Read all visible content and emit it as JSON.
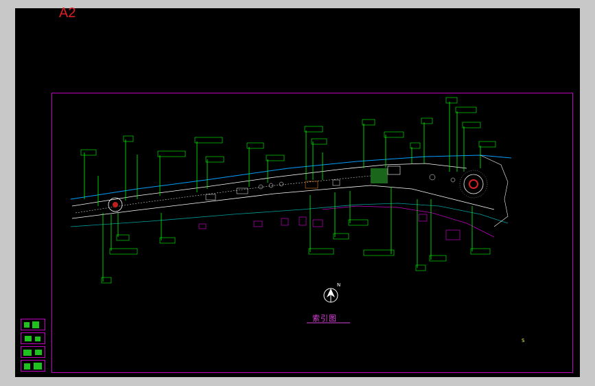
{
  "sheet": {
    "size_label": "A2",
    "index_title": "索引图",
    "north_label": "N",
    "footer_left": "",
    "footer_right": "",
    "footer_mark": "S"
  },
  "colors": {
    "background": "#000000",
    "frame": "#c000c0",
    "leader": "#00ff00",
    "path": "#ffffff",
    "shoreline": "#00a0ff",
    "accent": "#e040e0",
    "sheet_label": "#e02020"
  },
  "callouts": [
    {
      "id": "c1",
      "text": ""
    },
    {
      "id": "c2",
      "text": ""
    },
    {
      "id": "c3",
      "text": ""
    },
    {
      "id": "c4",
      "text": ""
    },
    {
      "id": "c5",
      "text": ""
    },
    {
      "id": "c6",
      "text": ""
    },
    {
      "id": "c7",
      "text": ""
    },
    {
      "id": "c8",
      "text": ""
    },
    {
      "id": "c9",
      "text": ""
    },
    {
      "id": "c10",
      "text": ""
    },
    {
      "id": "c11",
      "text": ""
    },
    {
      "id": "c12",
      "text": ""
    },
    {
      "id": "c13",
      "text": ""
    },
    {
      "id": "c14",
      "text": ""
    },
    {
      "id": "c15",
      "text": ""
    },
    {
      "id": "c16",
      "text": ""
    },
    {
      "id": "c17",
      "text": ""
    },
    {
      "id": "c18",
      "text": ""
    },
    {
      "id": "c19",
      "text": ""
    },
    {
      "id": "c20",
      "text": ""
    },
    {
      "id": "c21",
      "text": ""
    },
    {
      "id": "c22",
      "text": ""
    },
    {
      "id": "c23",
      "text": ""
    },
    {
      "id": "c24",
      "text": ""
    }
  ]
}
